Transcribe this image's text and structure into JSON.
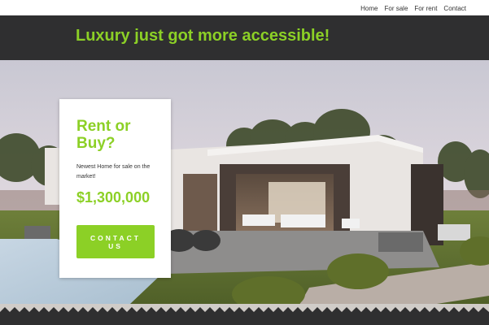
{
  "nav": {
    "links": [
      "Home",
      "For sale",
      "For rent",
      "Contact"
    ]
  },
  "header": {
    "headline": "Luxury just got more accessible!"
  },
  "hero": {
    "image": "modern-house-photo"
  },
  "listing": {
    "title": "Rent or Buy?",
    "description": "Newest Home for sale on the market!",
    "price": "$1,300,000",
    "button_label": "CONTACT US"
  },
  "colors": {
    "accent": "#8cd026",
    "header_bg": "#2f2f30",
    "text": "#333333"
  }
}
